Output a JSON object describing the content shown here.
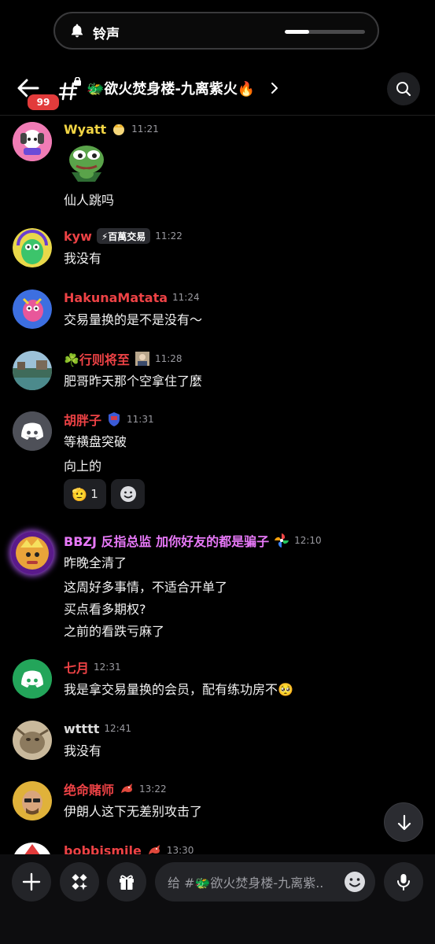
{
  "ringtone": {
    "label": "铃声",
    "volume_fraction": 0.3
  },
  "header": {
    "notification_count": "99",
    "channel_name": "🐲欲火焚身楼-九离紫火🔥"
  },
  "messages": [
    {
      "user": "Wyatt",
      "user_color": "#f2d544",
      "time": "11:21",
      "role_icon": "badge-emoji-icon",
      "sticker": "pepe-frog-sticker",
      "lines": [
        "仙人跳吗"
      ]
    },
    {
      "user": "kyw",
      "user_color": "#ed4245",
      "time": "11:22",
      "tag": "⚡百萬交易",
      "lines": [
        "我没有"
      ]
    },
    {
      "user": "HakunaMatata",
      "user_color": "#ed4245",
      "time": "11:24",
      "lines": [
        "交易量换的是不是没有～"
      ]
    },
    {
      "user": "☘️行则将至",
      "user_color": "#ed4245",
      "time": "11:28",
      "role_icon": "portrait-icon",
      "lines": [
        "肥哥昨天那个空拿住了麼"
      ]
    },
    {
      "user": "胡胖子",
      "user_color": "#ed4245",
      "time": "11:31",
      "role_icon": "armor-icon",
      "lines": [
        "等横盘突破",
        "向上的"
      ],
      "reactions": [
        {
          "emoji": "🫡",
          "count": "1"
        }
      ]
    },
    {
      "user": "BBZJ 反指总监  加你好友的都是骗子",
      "user_color": "#e879f9",
      "time": "12:10",
      "role_icon": "pinwheel-icon",
      "lines": [
        "昨晚全清了",
        "这周好多事情，不适合开单了",
        "买点看多期权?",
        "之前的看跌亏麻了"
      ]
    },
    {
      "user": "七月",
      "user_color": "#ed4245",
      "time": "12:31",
      "lines": [
        "我是拿交易量换的会员，配有练功房不🥺"
      ]
    },
    {
      "user": "wtttt",
      "user_color": "#dcdcdc",
      "time": "12:41",
      "lines": [
        "我没有"
      ]
    },
    {
      "user": "绝命赌师",
      "user_color": "#ed4245",
      "time": "13:22",
      "role_icon": "dragon-icon",
      "lines": [
        "伊朗人这下无差别攻击了"
      ]
    },
    {
      "user": "bobbismile",
      "user_color": "#ed4245",
      "time": "13:30",
      "role_icon": "dragon-icon",
      "lines": []
    }
  ],
  "composer": {
    "placeholder": "给 #🐲欲火焚身楼-九离紫.."
  },
  "colors": {
    "background": "#000000",
    "surface": "#232428",
    "badge": "#e23b3b",
    "discord_blurple": "#5865f2",
    "discord_gray": "#4e5058",
    "discord_green": "#23a55a"
  }
}
